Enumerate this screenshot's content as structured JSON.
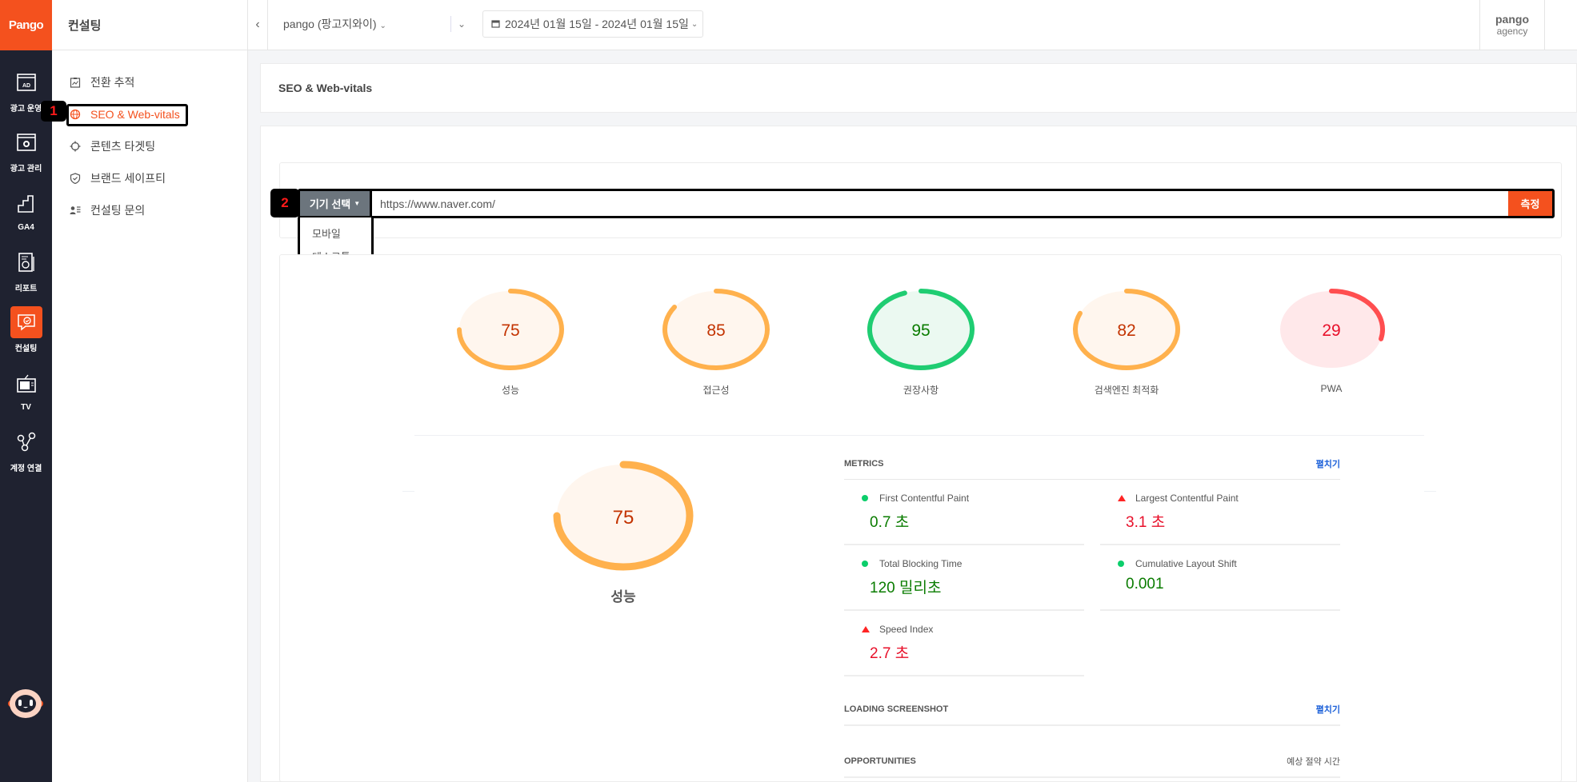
{
  "app": {
    "logo_text": "Pango",
    "brand_color": "#f4511e"
  },
  "rail": {
    "items": [
      {
        "label": "광고 운영",
        "icon": "ad-window-icon"
      },
      {
        "label": "광고 관리",
        "icon": "settings-window-icon"
      },
      {
        "label": "GA4",
        "icon": "ga4-chart-icon"
      },
      {
        "label": "리포트",
        "icon": "report-icon"
      },
      {
        "label": "컨설팅",
        "icon": "consulting-icon",
        "active": true
      },
      {
        "label": "TV",
        "icon": "tv-icon"
      },
      {
        "label": "계정 연결",
        "icon": "account-link-icon"
      }
    ]
  },
  "sidebar": {
    "title": "컨설팅",
    "items": [
      {
        "label": "전환 추적",
        "icon": "clipboard-chart-icon"
      },
      {
        "label": "SEO & Web-vitals",
        "icon": "globe-check-icon",
        "active": true
      },
      {
        "label": "콘텐츠 타겟팅",
        "icon": "crosshair-icon"
      },
      {
        "label": "브랜드 세이프티",
        "icon": "shield-check-icon"
      },
      {
        "label": "컨설팅 문의",
        "icon": "user-list-icon"
      }
    ]
  },
  "annotations": {
    "step1": "1",
    "step2": "2"
  },
  "topbar": {
    "account": "pango (팡고지와이)",
    "date_range": "2024년 01월 15일 - 2024년 01월 15일",
    "user_name": "pango",
    "user_role": "agency"
  },
  "page": {
    "title": "SEO & Web-vitals"
  },
  "url_form": {
    "device_button": "기기 선택",
    "device_options": [
      "모바일",
      "데스크톱"
    ],
    "url_value": "https://www.naver.com/",
    "measure_button": "측정"
  },
  "scores": [
    {
      "label": "성능",
      "value": 75,
      "status": "average",
      "color": "#ffa400"
    },
    {
      "label": "접근성",
      "value": 85,
      "status": "average",
      "color": "#ffa400"
    },
    {
      "label": "권장사항",
      "value": 95,
      "status": "good",
      "color": "#0cce6b"
    },
    {
      "label": "검색엔진 최적화",
      "value": 82,
      "status": "average",
      "color": "#ffa400"
    },
    {
      "label": "PWA",
      "value": 29,
      "status": "poor",
      "color": "#ff4e42"
    }
  ],
  "performance": {
    "label": "성능",
    "value": 75
  },
  "metrics": {
    "heading": "METRICS",
    "expand": "펼치기",
    "items": [
      {
        "name": "First Contentful Paint",
        "value": "0.7 초",
        "status": "good"
      },
      {
        "name": "Largest Contentful Paint",
        "value": "3.1 초",
        "status": "poor"
      },
      {
        "name": "Total Blocking Time",
        "value": "120 밀리초",
        "status": "good"
      },
      {
        "name": "Cumulative Layout Shift",
        "value": "0.001",
        "status": "good"
      },
      {
        "name": "Speed Index",
        "value": "2.7 초",
        "status": "poor"
      }
    ]
  },
  "loading_screenshot": {
    "heading": "LOADING SCREENSHOT",
    "expand": "펼치기"
  },
  "opportunities": {
    "heading": "OPPORTUNITIES",
    "right_label": "예상 절약 시간"
  }
}
